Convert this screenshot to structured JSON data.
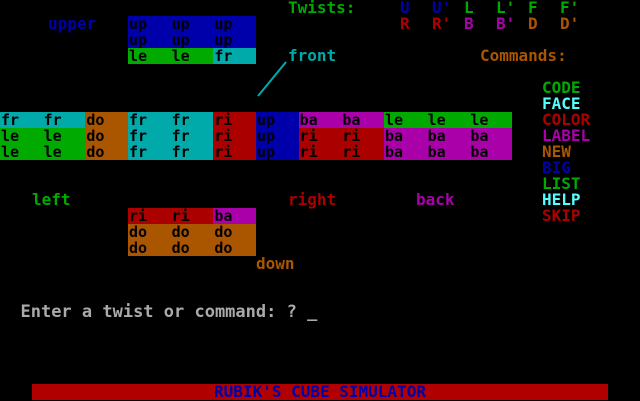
{
  "app": {
    "title": "RUBIK'S CUBE SIMULATOR"
  },
  "colors": {
    "cyan": "#00aaaa",
    "green": "#00aa00",
    "blue": "#0000aa",
    "red": "#aa0000",
    "magenta": "#aa00aa",
    "orange": "#aa5500",
    "black": "#000000",
    "label_blue": "#0000aa",
    "label_cyan": "#55ffff",
    "label_green": "#00aa00",
    "label_red": "#aa0000",
    "label_magenta": "#aa00aa",
    "label_orange": "#aa5500"
  },
  "twists": {
    "heading": "Twists:",
    "row1": [
      "U",
      "U'",
      "L",
      "L'",
      "F",
      "F'"
    ],
    "row2": [
      "R",
      "R'",
      "B",
      "B'",
      "D",
      "D'"
    ]
  },
  "commands": {
    "heading": "Commands:",
    "items": [
      "CODE",
      "FACE",
      "COLOR",
      "LABEL",
      "NEW",
      "BIG",
      "LIST",
      "HELP",
      "SKIP"
    ]
  },
  "face_labels": {
    "upper": "upper",
    "front": "front",
    "left": "left",
    "right": "right",
    "back": "back",
    "down": "down"
  },
  "faces": {
    "upper": [
      [
        "up",
        "up",
        "up"
      ],
      [
        "up",
        "up",
        "up"
      ],
      [
        "le",
        "le",
        "fr"
      ]
    ],
    "left": [
      [
        "fr",
        "fr",
        "do"
      ],
      [
        "le",
        "le",
        "do"
      ],
      [
        "le",
        "le",
        "do"
      ]
    ],
    "front": [
      [
        "fr",
        "fr",
        "ri"
      ],
      [
        "fr",
        "fr",
        "ri"
      ],
      [
        "fr",
        "fr",
        "ri"
      ]
    ],
    "right": [
      [
        "up",
        "ba",
        "ba"
      ],
      [
        "up",
        "ri",
        "ri"
      ],
      [
        "up",
        "ri",
        "ri"
      ]
    ],
    "back": [
      [
        "le",
        "le",
        "le"
      ],
      [
        "ba",
        "ba",
        "ba"
      ],
      [
        "ba",
        "ba",
        "ba"
      ]
    ],
    "down": [
      [
        "ri",
        "ri",
        "ba"
      ],
      [
        "do",
        "do",
        "do"
      ],
      [
        "do",
        "do",
        "do"
      ]
    ]
  },
  "prompt": {
    "text": "Enter a twist or command: ? ",
    "cursor": "_"
  }
}
